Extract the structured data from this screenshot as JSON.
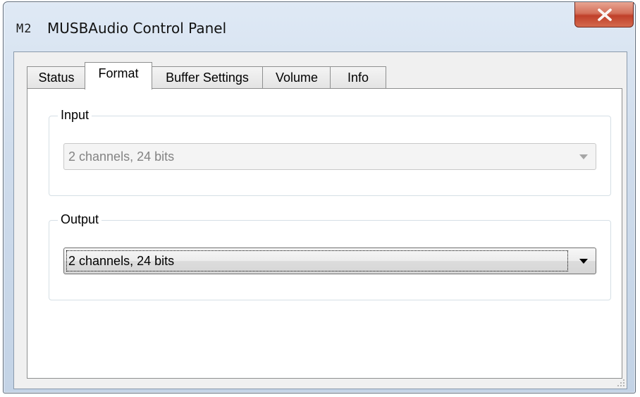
{
  "window": {
    "icon_label": "M2",
    "title": "MUSBAudio Control Panel"
  },
  "tabs": [
    {
      "label": "Status",
      "active": false
    },
    {
      "label": "Format",
      "active": true
    },
    {
      "label": "Buffer Settings",
      "active": false
    },
    {
      "label": "Volume",
      "active": false
    },
    {
      "label": "Info",
      "active": false
    }
  ],
  "input_group": {
    "label": "Input",
    "selected_value": "2 channels, 24 bits",
    "enabled": false
  },
  "output_group": {
    "label": "Output",
    "selected_value": "2 channels, 24 bits",
    "enabled": true
  },
  "icons": {
    "close": "close-icon",
    "dropdown": "chevron-down-icon",
    "grip": "resize-grip-icon"
  },
  "colors": {
    "close_button": "#c7462f",
    "panel_background": "#ffffff",
    "client_background": "#f0f0f0",
    "disabled_text": "#838383"
  }
}
